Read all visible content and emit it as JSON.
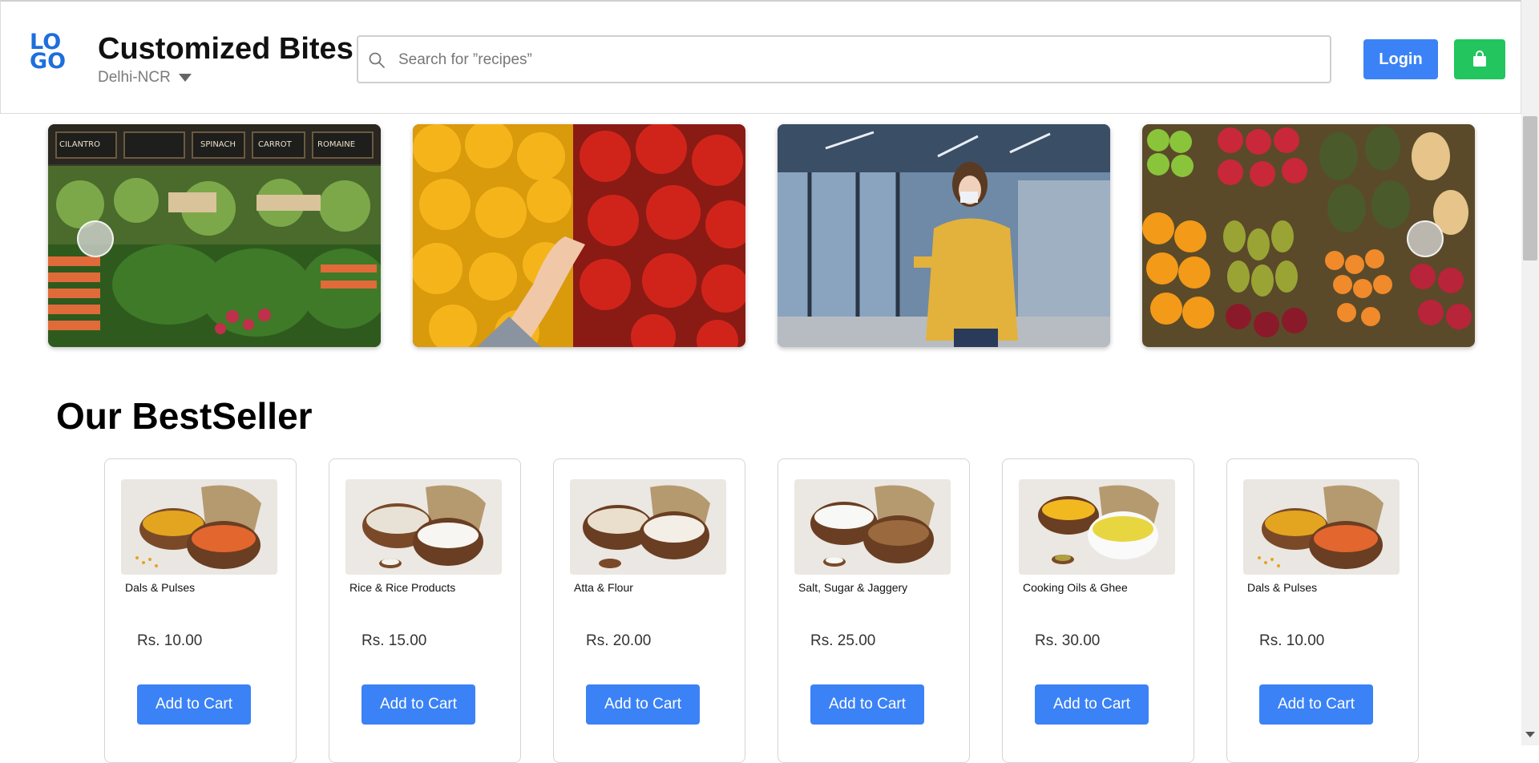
{
  "header": {
    "logo_lines": [
      "LO",
      "GO"
    ],
    "brand_title": "Customized Bites",
    "location": "Delhi-NCR",
    "search_placeholder": "Search for ”recipes”",
    "login_label": "Login",
    "cart_icon": "shopping-bag-icon",
    "accent_color": "#3b82f6",
    "cart_color": "#22c55e"
  },
  "section": {
    "bestseller_title": "Our BestSeller"
  },
  "products": [
    {
      "name": "Dals & Pulses",
      "price": "Rs. 10.00",
      "button": "Add to Cart"
    },
    {
      "name": "Rice & Rice Products",
      "price": "Rs. 15.00",
      "button": "Add to Cart"
    },
    {
      "name": "Atta & Flour",
      "price": "Rs. 20.00",
      "button": "Add to Cart"
    },
    {
      "name": "Salt, Sugar & Jaggery",
      "price": "Rs. 25.00",
      "button": "Add to Cart"
    },
    {
      "name": "Cooking Oils & Ghee",
      "price": "Rs. 30.00",
      "button": "Add to Cart"
    },
    {
      "name": "Dals & Pulses",
      "price": "Rs. 10.00",
      "button": "Add to Cart"
    }
  ],
  "banner_chalkboard": [
    "CILANTRO",
    "SPINACH",
    "CARROT",
    "ROMAINE"
  ]
}
